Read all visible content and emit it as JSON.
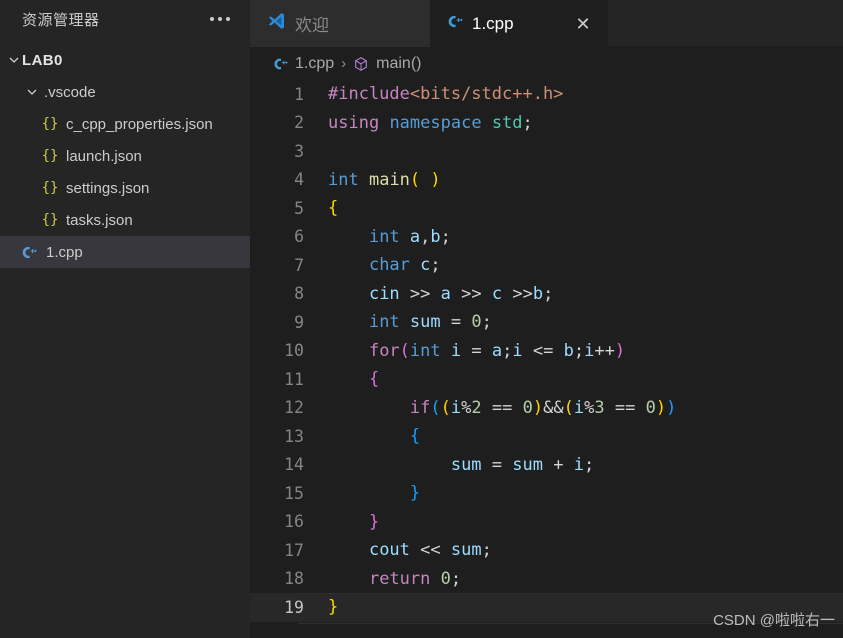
{
  "sidebar": {
    "header": {
      "title": "资源管理器",
      "more_icon": "ellipsis-icon"
    },
    "root": {
      "label": "LAB0",
      "expanded": true
    },
    "items": [
      {
        "label": ".vscode",
        "type": "folder",
        "expanded": true,
        "indent": 1,
        "icon": "chevron-down-icon"
      },
      {
        "label": "c_cpp_properties.json",
        "type": "json",
        "indent": 2,
        "icon": "json-braces-icon"
      },
      {
        "label": "launch.json",
        "type": "json",
        "indent": 2,
        "icon": "json-braces-icon"
      },
      {
        "label": "settings.json",
        "type": "json",
        "indent": 2,
        "icon": "json-braces-icon"
      },
      {
        "label": "tasks.json",
        "type": "json",
        "indent": 2,
        "icon": "json-braces-icon"
      },
      {
        "label": "1.cpp",
        "type": "cpp",
        "indent": 1,
        "icon": "cpp-file-icon",
        "selected": true
      }
    ]
  },
  "tabs": [
    {
      "label": "欢迎",
      "icon": "vscode-logo-icon",
      "active": false,
      "closable": false
    },
    {
      "label": "1.cpp",
      "icon": "cpp-file-icon",
      "active": true,
      "closable": true,
      "close_label": "✕"
    }
  ],
  "breadcrumb": {
    "file_icon": "cpp-file-icon",
    "file": "1.cpp",
    "separator": "›",
    "symbol_icon": "cube-symbol-icon",
    "symbol": "main()"
  },
  "editor": {
    "active_line": 19,
    "lines": [
      {
        "n": 1,
        "indent_guides": []
      },
      {
        "n": 2,
        "indent_guides": []
      },
      {
        "n": 3,
        "indent_guides": []
      },
      {
        "n": 4,
        "indent_guides": []
      },
      {
        "n": 5,
        "indent_guides": []
      },
      {
        "n": 6,
        "indent_guides": [
          0
        ]
      },
      {
        "n": 7,
        "indent_guides": [
          0
        ]
      },
      {
        "n": 8,
        "indent_guides": [
          0
        ]
      },
      {
        "n": 9,
        "indent_guides": [
          0
        ]
      },
      {
        "n": 10,
        "indent_guides": [
          0
        ]
      },
      {
        "n": 11,
        "indent_guides": [
          0
        ]
      },
      {
        "n": 12,
        "indent_guides": [
          0,
          1
        ]
      },
      {
        "n": 13,
        "indent_guides": [
          0,
          1
        ]
      },
      {
        "n": 14,
        "indent_guides": [
          0,
          1,
          2
        ]
      },
      {
        "n": 15,
        "indent_guides": [
          0,
          1
        ]
      },
      {
        "n": 16,
        "indent_guides": [
          0
        ]
      },
      {
        "n": 17,
        "indent_guides": [
          0
        ]
      },
      {
        "n": 18,
        "indent_guides": [
          0
        ]
      },
      {
        "n": 19,
        "indent_guides": []
      }
    ],
    "source": [
      "#include<bits/stdc++.h>",
      "using namespace std;",
      "",
      "int main( )",
      "{",
      "    int a,b;",
      "    char c;",
      "    cin >> a >> c >>b;",
      "    int sum = 0;",
      "    for(int i = a;i <= b;i++)",
      "    {",
      "        if((i%2 == 0)&&(i%3 == 0))",
      "        {",
      "            sum = sum + i;",
      "        }",
      "    }",
      "    cout << sum;",
      "    return 0;",
      "}"
    ],
    "tokens": [
      [
        [
          "#include",
          "ctl"
        ],
        [
          "<bits/stdc++.h>",
          "str"
        ]
      ],
      [
        [
          "using",
          "ctl"
        ],
        [
          " ",
          "op"
        ],
        [
          "namespace",
          "kw"
        ],
        [
          " ",
          "op"
        ],
        [
          "std",
          "cls"
        ],
        [
          ";",
          "op"
        ]
      ],
      [],
      [
        [
          "int",
          "kw"
        ],
        [
          " ",
          "op"
        ],
        [
          "main",
          "fn"
        ],
        [
          "(",
          "b1"
        ],
        [
          " ",
          "op"
        ],
        [
          ")",
          "b1"
        ]
      ],
      [
        [
          "{",
          "b1"
        ]
      ],
      [
        [
          "    ",
          "op"
        ],
        [
          "int",
          "kw"
        ],
        [
          " ",
          "op"
        ],
        [
          "a",
          "var"
        ],
        [
          ",",
          "op"
        ],
        [
          "b",
          "var"
        ],
        [
          ";",
          "op"
        ]
      ],
      [
        [
          "    ",
          "op"
        ],
        [
          "char",
          "kw"
        ],
        [
          " ",
          "op"
        ],
        [
          "c",
          "var"
        ],
        [
          ";",
          "op"
        ]
      ],
      [
        [
          "    ",
          "op"
        ],
        [
          "cin",
          "var"
        ],
        [
          " ",
          "op"
        ],
        [
          ">>",
          "op"
        ],
        [
          " ",
          "op"
        ],
        [
          "a",
          "var"
        ],
        [
          " ",
          "op"
        ],
        [
          ">>",
          "op"
        ],
        [
          " ",
          "op"
        ],
        [
          "c",
          "var"
        ],
        [
          " ",
          "op"
        ],
        [
          ">>",
          "op"
        ],
        [
          "b",
          "var"
        ],
        [
          ";",
          "op"
        ]
      ],
      [
        [
          "    ",
          "op"
        ],
        [
          "int",
          "kw"
        ],
        [
          " ",
          "op"
        ],
        [
          "sum",
          "var"
        ],
        [
          " ",
          "op"
        ],
        [
          "=",
          "op"
        ],
        [
          " ",
          "op"
        ],
        [
          "0",
          "num"
        ],
        [
          ";",
          "op"
        ]
      ],
      [
        [
          "    ",
          "op"
        ],
        [
          "for",
          "ctl"
        ],
        [
          "(",
          "b2"
        ],
        [
          "int",
          "kw"
        ],
        [
          " ",
          "op"
        ],
        [
          "i",
          "var"
        ],
        [
          " ",
          "op"
        ],
        [
          "=",
          "op"
        ],
        [
          " ",
          "op"
        ],
        [
          "a",
          "var"
        ],
        [
          ";",
          "op"
        ],
        [
          "i",
          "var"
        ],
        [
          " ",
          "op"
        ],
        [
          "<=",
          "op"
        ],
        [
          " ",
          "op"
        ],
        [
          "b",
          "var"
        ],
        [
          ";",
          "op"
        ],
        [
          "i",
          "var"
        ],
        [
          "++",
          "op"
        ],
        [
          ")",
          "b2"
        ]
      ],
      [
        [
          "    ",
          "op"
        ],
        [
          "{",
          "b2"
        ]
      ],
      [
        [
          "        ",
          "op"
        ],
        [
          "if",
          "ctl"
        ],
        [
          "(",
          "b3"
        ],
        [
          "(",
          "b1"
        ],
        [
          "i",
          "var"
        ],
        [
          "%",
          "op"
        ],
        [
          "2",
          "num"
        ],
        [
          " ",
          "op"
        ],
        [
          "==",
          "op"
        ],
        [
          " ",
          "op"
        ],
        [
          "0",
          "num"
        ],
        [
          ")",
          "b1"
        ],
        [
          "&&",
          "op"
        ],
        [
          "(",
          "b1"
        ],
        [
          "i",
          "var"
        ],
        [
          "%",
          "op"
        ],
        [
          "3",
          "num"
        ],
        [
          " ",
          "op"
        ],
        [
          "==",
          "op"
        ],
        [
          " ",
          "op"
        ],
        [
          "0",
          "num"
        ],
        [
          ")",
          "b1"
        ],
        [
          ")",
          "b3"
        ]
      ],
      [
        [
          "        ",
          "op"
        ],
        [
          "{",
          "b3"
        ]
      ],
      [
        [
          "            ",
          "op"
        ],
        [
          "sum",
          "var"
        ],
        [
          " ",
          "op"
        ],
        [
          "=",
          "op"
        ],
        [
          " ",
          "op"
        ],
        [
          "sum",
          "var"
        ],
        [
          " ",
          "op"
        ],
        [
          "+",
          "op"
        ],
        [
          " ",
          "op"
        ],
        [
          "i",
          "var"
        ],
        [
          ";",
          "op"
        ]
      ],
      [
        [
          "        ",
          "op"
        ],
        [
          "}",
          "b3"
        ]
      ],
      [
        [
          "    ",
          "op"
        ],
        [
          "}",
          "b2"
        ]
      ],
      [
        [
          "    ",
          "op"
        ],
        [
          "cout",
          "var"
        ],
        [
          " ",
          "op"
        ],
        [
          "<<",
          "op"
        ],
        [
          " ",
          "op"
        ],
        [
          "sum",
          "var"
        ],
        [
          ";",
          "op"
        ]
      ],
      [
        [
          "    ",
          "op"
        ],
        [
          "return",
          "ctl"
        ],
        [
          " ",
          "op"
        ],
        [
          "0",
          "num"
        ],
        [
          ";",
          "op"
        ]
      ],
      [
        [
          "}",
          "b1"
        ]
      ]
    ]
  },
  "watermark": {
    "text": "CSDN @啦啦右一"
  },
  "colors": {
    "editor_bg": "#1e1e1e",
    "sidebar_bg": "#252526",
    "tabbar_bg": "#252526",
    "tab_inactive_bg": "#2d2d2d",
    "selection_bg": "#37373d",
    "accent_blue": "#007acc",
    "cpp_icon": "#5c99d6",
    "json_icon": "#cbcb41",
    "line_number": "#858585"
  }
}
